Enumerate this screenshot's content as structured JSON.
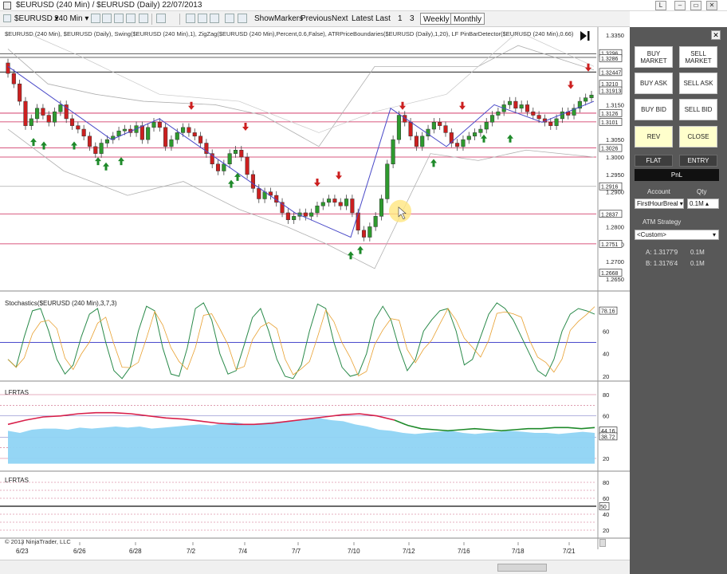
{
  "window": {
    "title": "$EURUSD (240 Min) / $EURUSD (Daily)  22/07/2013",
    "controls": [
      "L",
      "–",
      "▭",
      "✕"
    ]
  },
  "toolbar": {
    "instrument": "$EURUSD",
    "interval": "240 Min",
    "show_markers": "ShowMarkers",
    "previous": "Previous",
    "next": "Next",
    "latest": "Latest",
    "last": "Last",
    "num1": "1",
    "num3": "3",
    "weekly": "Weekly",
    "monthly": "Monthly"
  },
  "panels": {
    "price_caption": "$EURUSD (240 Min), $EURUSD (Daily), Swing($EURUSD (240 Min),1), ZigZag($EURUSD (240 Min),Percent,0.6,False), ATRPriceBoundaries($EURUSD (Daily),1,20), LF PinBarDetector($EURUSD (240 Min),0.66)",
    "stoch_caption": "Stochastics($EURUSD (240 Min),3,7,3)",
    "lfrtas1_caption": "LFRTAS",
    "lfrtas2_caption": "LFRTAS",
    "copyright": "© 2013 NinjaTrader, LLC"
  },
  "price_axis": {
    "ticks": [
      "1.3350",
      "1.3150",
      "1.3050",
      "1.3000",
      "1.2950",
      "1.2900",
      "1.2800",
      "1.2750",
      "1.2700",
      "1.2650"
    ],
    "boxes": [
      "1.3296",
      "1.3286",
      "1.32447",
      "1.3210",
      "1.31913",
      "1.3126",
      "1.3101",
      "1.3026",
      "1.2916",
      "1.2837",
      "1.2751",
      "1.2668"
    ]
  },
  "stoch_axis": {
    "ticks": [
      "60",
      "40",
      "20"
    ],
    "value": "78.16"
  },
  "lfrtas1_axis": {
    "ticks": [
      "80",
      "60",
      "40",
      "20"
    ],
    "values": [
      "44.16",
      "38.72"
    ]
  },
  "lfrtas2_axis": {
    "ticks": [
      "80",
      "60",
      "40",
      "20"
    ],
    "value": "50"
  },
  "x_axis": {
    "labels": [
      "6/23",
      "6/26",
      "6/28",
      "7/2",
      "7/4",
      "7/7",
      "7/10",
      "7/12",
      "7/16",
      "7/18",
      "7/21"
    ]
  },
  "side_panel": {
    "buy_market": "BUY MARKET",
    "sell_market": "SELL MARKET",
    "buy_ask": "BUY ASK",
    "sell_ask": "SELL ASK",
    "buy_bid": "BUY BID",
    "sell_bid": "SELL BID",
    "rev": "REV",
    "close": "CLOSE",
    "flat": "FLAT",
    "entry": "ENTRY",
    "pnl": "PnL",
    "account_label": "Account",
    "qty_label": "Qty",
    "account_value": "FirstHourBreal",
    "qty_value": "0.1M",
    "atm_label": "ATM Strategy",
    "atm_value": "<Custom>",
    "ask_line": "A: 1.3177'9",
    "ask_qty": "0.1M",
    "bid_line": "B: 1.3176'4",
    "bid_qty": "0.1M"
  },
  "colors": {
    "up_candle": "#2e9a2e",
    "down_candle": "#cc1f1f",
    "hline": "#cc2255",
    "zigzag": "#4a4ac8",
    "stoch_k": "#2a8a4a",
    "stoch_d": "#e8a030",
    "lfrtas_fill": "#8fd4f4",
    "lfrtas_red": "#d8204a",
    "lfrtas_green": "#1e8a2a"
  }
}
